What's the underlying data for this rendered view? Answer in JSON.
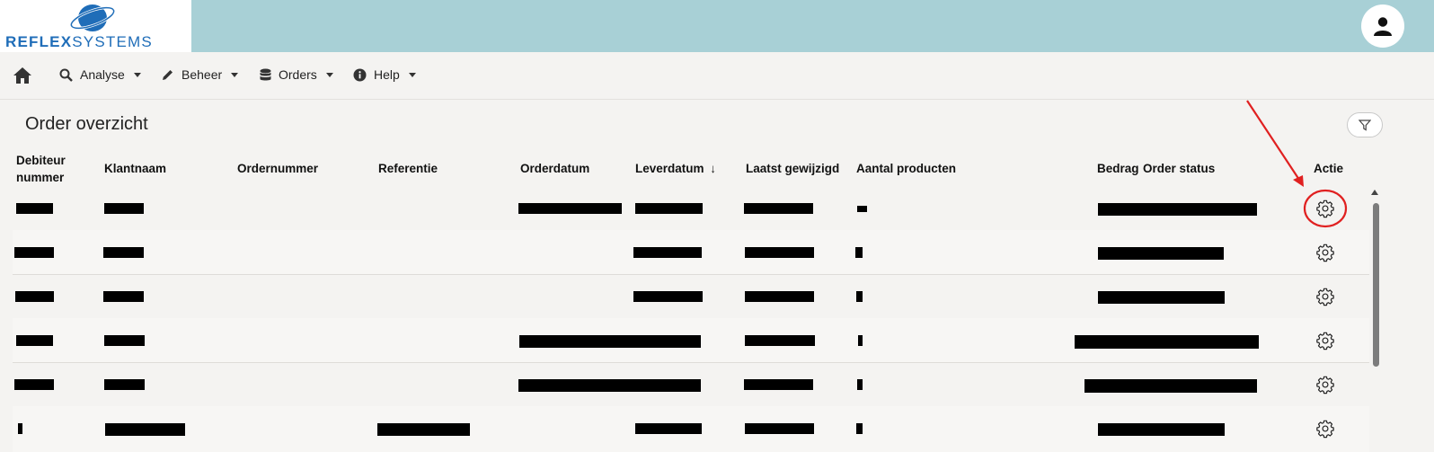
{
  "brand": {
    "bold": "REFLEX",
    "light": "SYSTEMS"
  },
  "nav": {
    "items": [
      {
        "label": "Analyse",
        "icon": "search-chart-icon"
      },
      {
        "label": "Beheer",
        "icon": "pencil-icon"
      },
      {
        "label": "Orders",
        "icon": "database-icon"
      },
      {
        "label": "Help",
        "icon": "info-icon"
      }
    ]
  },
  "page": {
    "title": "Order overzicht"
  },
  "table": {
    "headers": {
      "debiteur_1": "Debiteur",
      "debiteur_2": "nummer",
      "klantnaam": "Klantnaam",
      "ordernummer": "Ordernummer",
      "referentie": "Referentie",
      "orderdatum": "Orderdatum",
      "leverdatum": "Leverdatum",
      "sort_indicator": "↓",
      "laatst": "Laatst gewijzigd",
      "aantal": "Aantal producten",
      "bedrag": "Bedrag",
      "status": "Order status",
      "actie": "Actie"
    },
    "rows_note_redacted": true
  },
  "colors": {
    "header_bar": "#a8d0d6",
    "brand_blue": "#1f6db8",
    "annotation_red": "#e02020"
  }
}
